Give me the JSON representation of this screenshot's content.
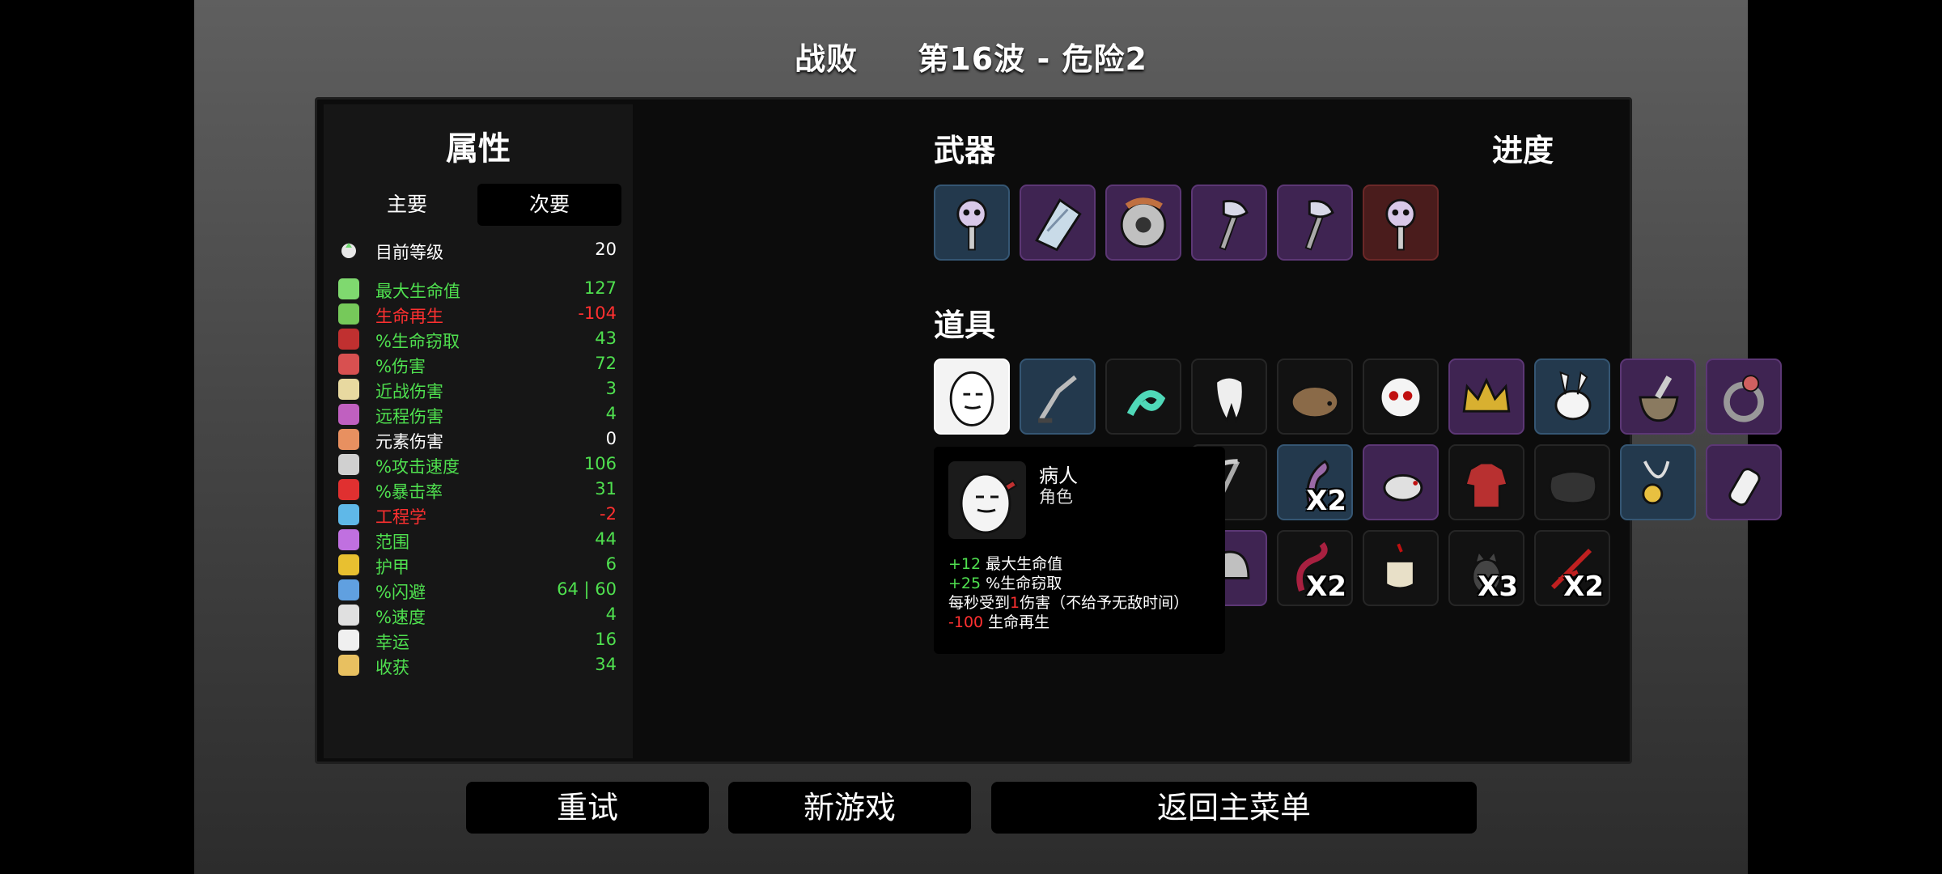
{
  "header": {
    "result": "战败",
    "wave": "第16波 - 危险2"
  },
  "stats": {
    "title": "属性",
    "tabs": {
      "primary": "主要",
      "secondary": "次要"
    },
    "level": {
      "name": "目前等级",
      "value": "20"
    },
    "items": [
      {
        "name": "最大生命值",
        "value": "127",
        "color": "#4fe04f",
        "icon": "heart-icon",
        "iconColor": "#7fd96f"
      },
      {
        "name": "生命再生",
        "value": "-104",
        "color": "#ff3030",
        "icon": "heart-plus-icon",
        "iconColor": "#76c95a"
      },
      {
        "name": "%生命窃取",
        "value": "43",
        "color": "#4fe04f",
        "icon": "fang-icon",
        "iconColor": "#c03030"
      },
      {
        "name": "%伤害",
        "value": "72",
        "color": "#4fe04f",
        "icon": "muscle-icon",
        "iconColor": "#d85050"
      },
      {
        "name": "近战伤害",
        "value": "3",
        "color": "#4fe04f",
        "icon": "sword-icon",
        "iconColor": "#e8d9a0"
      },
      {
        "name": "远程伤害",
        "value": "4",
        "color": "#4fe04f",
        "icon": "bow-icon",
        "iconColor": "#c060c0"
      },
      {
        "name": "元素伤害",
        "value": "0",
        "color": "#ffffff",
        "icon": "flame-icon",
        "iconColor": "#e89060"
      },
      {
        "name": "%攻击速度",
        "value": "106",
        "color": "#4fe04f",
        "icon": "hourglass-icon",
        "iconColor": "#d0d0d0"
      },
      {
        "name": "%暴击率",
        "value": "31",
        "color": "#4fe04f",
        "icon": "crit-icon",
        "iconColor": "#e03030"
      },
      {
        "name": "工程学",
        "value": "-2",
        "color": "#ff3030",
        "icon": "wrench-icon",
        "iconColor": "#5fb8e8"
      },
      {
        "name": "范围",
        "value": "44",
        "color": "#4fe04f",
        "icon": "range-icon",
        "iconColor": "#c070e0"
      },
      {
        "name": "护甲",
        "value": "6",
        "color": "#4fe04f",
        "icon": "shield-icon",
        "iconColor": "#e8c030"
      },
      {
        "name": "%闪避",
        "value": "64 | 60",
        "color": "#4fe04f",
        "icon": "dodge-icon",
        "iconColor": "#60a0e0"
      },
      {
        "name": "%速度",
        "value": "4",
        "color": "#4fe04f",
        "icon": "boot-icon",
        "iconColor": "#e0e0e0"
      },
      {
        "name": "幸运",
        "value": "16",
        "color": "#4fe04f",
        "icon": "dice-icon",
        "iconColor": "#f0f0f0"
      },
      {
        "name": "收获",
        "value": "34",
        "color": "#4fe04f",
        "icon": "wheat-icon",
        "iconColor": "#e8c060"
      }
    ]
  },
  "weapons": {
    "title": "武器",
    "slots": [
      {
        "icon": "skull-mace-icon",
        "tier": "blue"
      },
      {
        "icon": "crystal-shard-icon",
        "tier": "purple"
      },
      {
        "icon": "buzzsaw-icon",
        "tier": "purple"
      },
      {
        "icon": "axe-icon",
        "tier": "purple"
      },
      {
        "icon": "axe-icon",
        "tier": "purple"
      },
      {
        "icon": "skull-mace-icon",
        "tier": "red"
      }
    ]
  },
  "progress": {
    "title": "进度"
  },
  "items": {
    "title": "道具",
    "row1": [
      {
        "icon": "egg-patient-icon",
        "tier": "white"
      },
      {
        "icon": "grabber-tool-icon",
        "tier": "blue"
      },
      {
        "icon": "worm-icon",
        "tier": "dark"
      },
      {
        "icon": "tooth-icon",
        "tier": "dark"
      },
      {
        "icon": "hedgehog-icon",
        "tier": "dark"
      },
      {
        "icon": "ghost-face-icon",
        "tier": "dark"
      },
      {
        "icon": "crown-icon",
        "tier": "purple"
      },
      {
        "icon": "rabbit-icon",
        "tier": "blue"
      },
      {
        "icon": "mortar-icon",
        "tier": "purple"
      },
      {
        "icon": "ring-icon",
        "tier": "purple"
      }
    ],
    "row2": [
      {
        "icon": "scythe-icon",
        "tier": "dark",
        "count": ""
      },
      {
        "icon": "tentacle-icon",
        "tier": "blue",
        "count": "X2"
      },
      {
        "icon": "rat-icon",
        "tier": "purple",
        "count": ""
      },
      {
        "icon": "plaid-shirt-icon",
        "tier": "dark",
        "count": ""
      },
      {
        "icon": "cloth-icon",
        "tier": "dark",
        "count": ""
      },
      {
        "icon": "pendant-icon",
        "tier": "blue",
        "count": ""
      },
      {
        "icon": "bottle-icon",
        "tier": "purple",
        "count": ""
      }
    ],
    "row3": [
      {
        "icon": "helmet-icon",
        "tier": "purple",
        "count": ""
      },
      {
        "icon": "snake-icon",
        "tier": "dark",
        "count": "X2"
      },
      {
        "icon": "cup-icon",
        "tier": "dark",
        "count": ""
      },
      {
        "icon": "cat-icon",
        "tier": "dark",
        "count": "X3"
      },
      {
        "icon": "red-claw-icon",
        "tier": "dark",
        "count": "X2"
      }
    ]
  },
  "tooltip": {
    "name": "病人",
    "type": "角色",
    "lines": [
      {
        "prefix": "+12",
        "text": " 最大生命值"
      },
      {
        "prefix": "+25",
        "text": " %生命窃取"
      },
      {
        "pre": "每秒受到",
        "num": "1",
        "post": "伤害（不给予无敌时间）"
      },
      {
        "prefix": "-100",
        "text": " 生命再生"
      }
    ]
  },
  "buttons": {
    "retry": "重试",
    "new_game": "新游戏",
    "main_menu": "返回主菜单"
  }
}
